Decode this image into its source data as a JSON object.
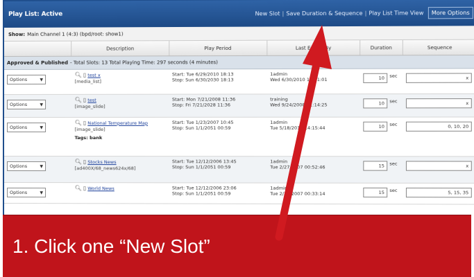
{
  "window": {
    "playlist_title": "Play List: Active",
    "toolbar": {
      "new_slot": "New Slot",
      "save_duration_sequence": "Save Duration & Sequence",
      "time_view": "Play List Time View",
      "more_options": "More Options"
    }
  },
  "show": {
    "label": "Show:",
    "value": "Main Channel 1 (4:3) (bpd/root: show1)"
  },
  "columns": {
    "description": "Description",
    "play_period": "Play Period",
    "last_edited_by": "Last Edited By",
    "duration": "Duration",
    "sequence": "Sequence"
  },
  "group": {
    "title": "Approved & Published",
    "summary": "- Total Slots: 13  Total Playing Time: 297 seconds (4 minutes)"
  },
  "rows": [
    {
      "options": "Options",
      "name": "test x",
      "type": "[media_list]",
      "start": "Start: Tue 6/29/2010 18:13",
      "stop": "Stop: Sun 6/30/2030 18:13",
      "user": "1admin",
      "edited": "Wed 6/30/2010 18:21:01",
      "duration": "10",
      "sec": "sec",
      "sequence": "x",
      "tags": ""
    },
    {
      "options": "Options",
      "name": "test",
      "type": "[image_slide]",
      "start": "Start: Mon 7/21/2008 11:36",
      "stop": "Stop: Fri 7/21/2028 11:36",
      "user": "training",
      "edited": "Wed 9/24/2008 11:14:25",
      "duration": "10",
      "sec": "sec",
      "sequence": "x",
      "tags": ""
    },
    {
      "options": "Options",
      "name": "National Temperature Map",
      "type": "[image_slide]",
      "start": "Start: Tue 1/23/2007 10:45",
      "stop": "Stop: Sun 1/1/2051 00:59",
      "user": "1admin",
      "edited": "Tue 5/18/2010 14:15:44",
      "duration": "10",
      "sec": "sec",
      "sequence": "0, 10, 20",
      "tags": "Tags: bank"
    },
    {
      "options": "Options",
      "name": "Stocks News",
      "type": "[ad400X/68_news624x/68]",
      "start": "Start: Tue 12/12/2006 13:45",
      "stop": "Stop: Sun 1/1/2051 00:59",
      "user": "1admin",
      "edited": "Tue 2/27/2007 00:52:46",
      "duration": "15",
      "sec": "sec",
      "sequence": "x",
      "tags": ""
    },
    {
      "options": "Options",
      "name": "World News",
      "type": "",
      "start": "Start: Tue 12/12/2006 23:06",
      "stop": "Stop: Sun 1/1/2051 00:59",
      "user": "1admin",
      "edited": "Tue 2/27/2007 00:33:14",
      "duration": "15",
      "sec": "sec",
      "sequence": "5, 15, 35",
      "tags": ""
    }
  ],
  "caption": {
    "text": "1. Click one “New Slot”",
    "background": "#c0141b",
    "color": "#ffffff"
  },
  "arrow": {
    "color": "#d01a20"
  }
}
